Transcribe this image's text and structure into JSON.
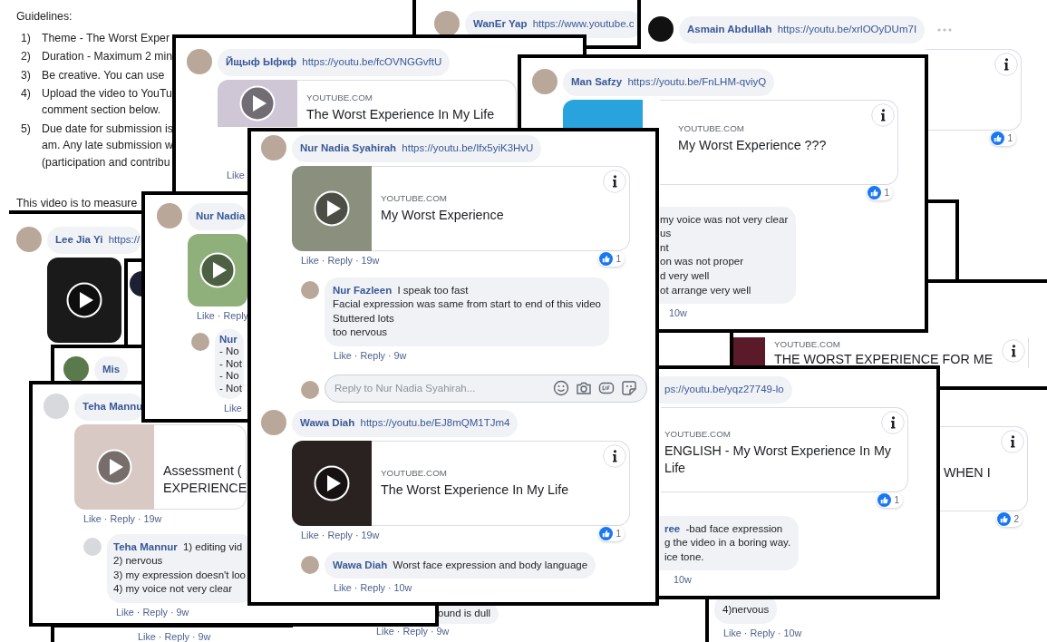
{
  "guidelines": {
    "heading": "Guidelines:",
    "items": [
      {
        "number": "1)",
        "lines": [
          "Theme - The Worst Exper"
        ]
      },
      {
        "number": "2)",
        "lines": [
          "Duration - Maximum 2 min"
        ]
      },
      {
        "number": "3)",
        "lines": [
          "Be creative. You can use"
        ]
      },
      {
        "number": "4)",
        "lines": [
          "Upload the video to YouTu",
          "comment section below."
        ]
      },
      {
        "number": "5)",
        "lines": [
          "Due date for submission is",
          "am. Any late submission w",
          "(participation and contribu"
        ]
      }
    ],
    "note": "This video is to measure"
  },
  "cards": [
    {
      "comments": [
        {
          "avatar": true,
          "author": "WanEr Yap",
          "link": "https://www.youtube.c"
        }
      ]
    },
    {
      "comments": [
        {
          "avatar": true,
          "author": "Asmain Abdullah",
          "link": "https://youtu.be/xrlOOyDUm7I",
          "menu": true,
          "preview": {
            "info": true,
            "likes": "1"
          }
        }
      ]
    },
    {
      "comments": [
        {
          "avatar": true,
          "author": "Йщыф Ыфкф",
          "link": "https://youtu.be/fcOVNGGvftU",
          "preview": {
            "video": true,
            "source": "YOUTUBE.COM",
            "title": [
              "The Worst Experience In My Life"
            ]
          },
          "actions": "Like"
        }
      ]
    },
    {
      "comments": [
        {
          "avatar": true,
          "author": "Man Safzy",
          "link": "https://youtu.be/FnLHM-qviyQ",
          "preview": {
            "video": true,
            "info": true,
            "source": "YOUTUBE.COM",
            "title": [
              "My Worst Experience ???"
            ],
            "likes": "1"
          },
          "replies": [
            {
              "lines": [
                "my voice was not very clear",
                "us",
                "nt",
                "on was not proper",
                "d very well",
                "ot arrange very well"
              ],
              "actions": "10w"
            }
          ]
        }
      ]
    },
    {
      "comments": [
        {
          "avatar": true,
          "author": "Nur Nadia Syahirah",
          "link": "https://youtu.be/Ifx5yiK3HvU",
          "preview": {
            "video": true,
            "info": true,
            "source": "YOUTUBE.COM",
            "title": [
              "My Worst Experience"
            ],
            "likes": "1"
          },
          "actions": "Like · Reply · 19w",
          "replies": [
            {
              "avatar": true,
              "author": "Nur Fazleen",
              "lines": [
                "I speak too fast",
                "Facial expression was same from start to end of this video",
                "Stuttered lots",
                "too nervous"
              ],
              "actions": "Like · Reply · 9w"
            }
          ],
          "reply_field": {
            "placeholder": "Reply to Nur Nadia Syahirah..."
          }
        },
        {
          "avatar": true,
          "author": "Wawa Diah",
          "link": "https://youtu.be/EJ8mQM1TJm4",
          "preview": {
            "video": true,
            "info": true,
            "source": "YOUTUBE.COM",
            "title": [
              "The Worst Experience In My Life"
            ],
            "likes": "1"
          },
          "actions": "Like · Reply · 19w",
          "replies": [
            {
              "avatar": true,
              "author": "Wawa Diah",
              "lines": [
                "Worst face expression and body language"
              ],
              "actions": "Like · Reply · 10w"
            }
          ]
        }
      ]
    },
    {
      "comments": [
        {
          "avatar": true,
          "author": "Nur Nadia",
          "preview": {
            "video": true
          },
          "actions": "Like · Reply",
          "replies": [
            {
              "avatar": true,
              "author": "Nur",
              "author_own_line": true,
              "lines": [
                "- No",
                "- Not",
                "- No",
                "- Not"
              ],
              "actions": "Like"
            }
          ]
        }
      ]
    },
    {
      "comments": [
        {
          "avatar": true,
          "author": "Lee Jia Yi",
          "link": "https://",
          "preview": {
            "video": true
          }
        }
      ]
    },
    {
      "comments": [
        {
          "avatar": true
        }
      ]
    },
    {
      "comments": [
        {
          "preview": {
            "video": true,
            "info": true,
            "source": "YOUTUBE.COM",
            "title": [
              "THE WORST EXPERIENCE FOR ME"
            ]
          }
        }
      ]
    },
    {
      "comments": [
        {
          "avatar": true,
          "author": "Mis"
        }
      ]
    },
    {
      "comments": [
        {
          "link": "ps://youtu.be/yqz27749-lo",
          "preview": {
            "info": true,
            "source": "YOUTUBE.COM",
            "title": [
              "ENGLISH - My Worst Experience In My",
              "Life"
            ],
            "likes": "1"
          },
          "replies": [
            {
              "author": "ree",
              "lines": [
                "-bad face expression",
                "g the video in a boring way.",
                "ice tone."
              ],
              "actions": "10w"
            }
          ]
        }
      ]
    },
    {
      "comments": [
        {
          "avatar": true,
          "author": "Teha Mannu",
          "preview": {
            "video": true,
            "title": [
              "Assessment (",
              "EXPERIENCE"
            ]
          },
          "actions": "Like · Reply · 19w",
          "replies": [
            {
              "avatar": true,
              "author": "Teha Mannur",
              "lines": [
                "1) editing vid",
                "2) nervous",
                "3) my expression doesn't loo",
                "4) my voice not very clear"
              ],
              "actions": "Like · Reply · 9w"
            }
          ]
        }
      ]
    },
    {
      "comments": [
        {
          "preview": {
            "info": true,
            "title": [
              "WHEN I"
            ],
            "likes": "2"
          }
        }
      ]
    },
    {
      "comments": [
        {
          "actions": "Like · Reply · 9w"
        }
      ]
    },
    {
      "comments": [
        {
          "lines": [
            "ound is dull"
          ],
          "actions": "Like · Reply · 9w"
        }
      ]
    },
    {
      "comments": [
        {
          "lines": [
            "4)nervous"
          ],
          "actions": "Like · Reply · 10w"
        }
      ]
    }
  ]
}
